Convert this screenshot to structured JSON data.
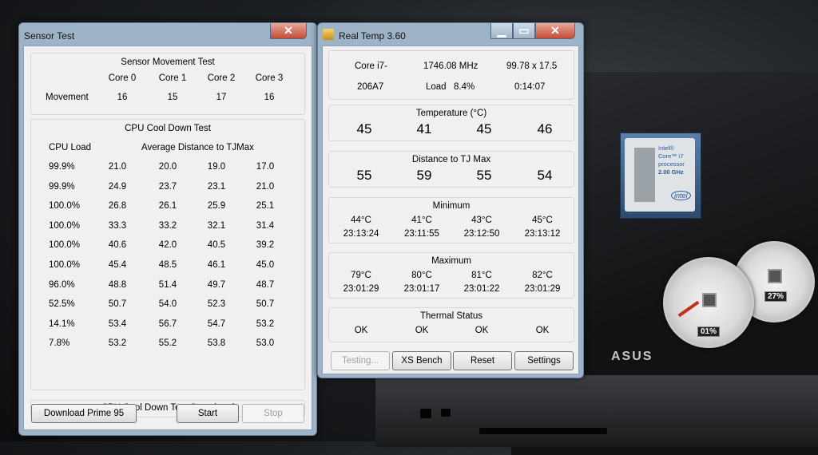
{
  "sensor_test": {
    "title": "Sensor Test",
    "close_glyph": "✕",
    "movement": {
      "group_title": "Sensor Movement Test",
      "cores": [
        "Core 0",
        "Core 1",
        "Core 2",
        "Core 3"
      ],
      "row_label": "Movement",
      "values": [
        "16",
        "15",
        "17",
        "16"
      ]
    },
    "cooldown": {
      "group_title": "CPU Cool Down Test",
      "col_load": "CPU Load",
      "col_avg": "Average Distance to TJMax",
      "rows": [
        [
          "99.9%",
          "21.0",
          "20.0",
          "19.0",
          "17.0"
        ],
        [
          "99.9%",
          "24.9",
          "23.7",
          "23.1",
          "21.0"
        ],
        [
          "100.0%",
          "26.8",
          "26.1",
          "25.9",
          "25.1"
        ],
        [
          "100.0%",
          "33.3",
          "33.2",
          "32.1",
          "31.4"
        ],
        [
          "100.0%",
          "40.6",
          "42.0",
          "40.5",
          "39.2"
        ],
        [
          "100.0%",
          "45.4",
          "48.5",
          "46.1",
          "45.0"
        ],
        [
          "96.0%",
          "48.8",
          "51.4",
          "49.7",
          "48.7"
        ],
        [
          "52.5%",
          "50.7",
          "54.0",
          "52.3",
          "50.7"
        ],
        [
          "14.1%",
          "53.4",
          "56.7",
          "54.7",
          "53.2"
        ],
        [
          "7.8%",
          "53.2",
          "55.2",
          "53.8",
          "53.0"
        ]
      ]
    },
    "status": "CPU Cool Down Test Completed",
    "buttons": {
      "download": "Download Prime 95",
      "start": "Start",
      "stop": "Stop"
    }
  },
  "real_temp": {
    "title": "Real Temp 3.60",
    "caption": {
      "minimize": "▁",
      "maximize": "▭",
      "close": "✕"
    },
    "info": {
      "cpu": "Core i7-",
      "model": "206A7",
      "freq": "1746.08 MHz",
      "load_label": "Load",
      "load": "8.4%",
      "multiplier": "99.78 x 17.5",
      "time": "0:14:07"
    },
    "temperature": {
      "title": "Temperature (°C)",
      "values": [
        "45",
        "41",
        "45",
        "46"
      ]
    },
    "distance": {
      "title": "Distance to TJ Max",
      "values": [
        "55",
        "59",
        "55",
        "54"
      ]
    },
    "minimum": {
      "title": "Minimum",
      "temps": [
        "44°C",
        "41°C",
        "43°C",
        "45°C"
      ],
      "times": [
        "23:13:24",
        "23:11:55",
        "23:12:50",
        "23:13:12"
      ]
    },
    "maximum": {
      "title": "Maximum",
      "temps": [
        "79°C",
        "80°C",
        "81°C",
        "82°C"
      ],
      "times": [
        "23:01:29",
        "23:01:17",
        "23:01:22",
        "23:01:29"
      ]
    },
    "thermal": {
      "title": "Thermal Status",
      "values": [
        "OK",
        "OK",
        "OK",
        "OK"
      ]
    },
    "buttons": {
      "testing": "Testing...",
      "xs_bench": "XS Bench",
      "reset": "Reset",
      "settings": "Settings"
    }
  },
  "desktop": {
    "badge": {
      "line1": "Intel®",
      "line2": "Core™ i7",
      "line3": "processor",
      "line4": "2.00 GHz",
      "logo": "intel"
    },
    "gauge_cpu": "01%",
    "gauge_mem": "27%",
    "laptop_logo": "ASUS"
  }
}
